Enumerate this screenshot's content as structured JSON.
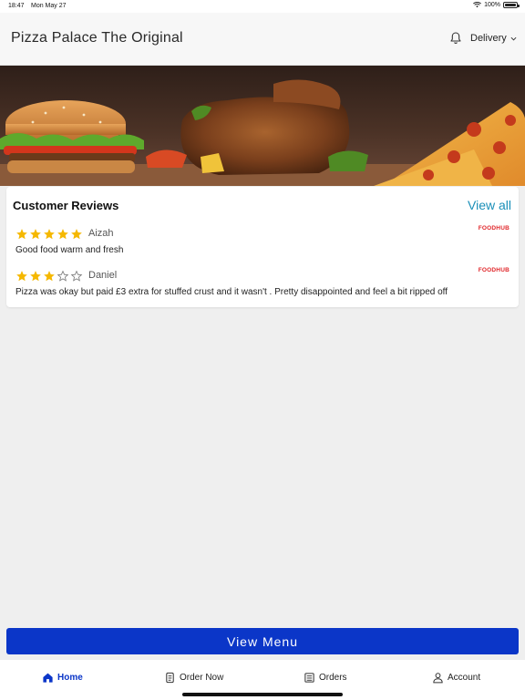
{
  "status_bar": {
    "time": "18:47",
    "date": "Mon May 27",
    "battery": "100%"
  },
  "header": {
    "title": "Pizza Palace The Original",
    "delivery_label": "Delivery"
  },
  "reviews": {
    "title": "Customer Reviews",
    "view_all": "View all",
    "items": [
      {
        "rating": 5,
        "max": 5,
        "name": "Aizah",
        "text": "Good food warm and fresh",
        "source": "FOODHUB"
      },
      {
        "rating": 3,
        "max": 5,
        "name": "Daniel",
        "text": "Pizza was okay but paid £3 extra for stuffed crust and it wasn't . Pretty disappointed and feel a bit ripped off",
        "source": "FOODHUB"
      }
    ]
  },
  "view_menu": "View Menu",
  "nav": {
    "home": "Home",
    "order_now": "Order Now",
    "orders": "Orders",
    "account": "Account"
  },
  "colors": {
    "primary": "#0b36c8",
    "link": "#1a8fb8",
    "star": "#f5b800",
    "foodhub": "#e0262a"
  }
}
